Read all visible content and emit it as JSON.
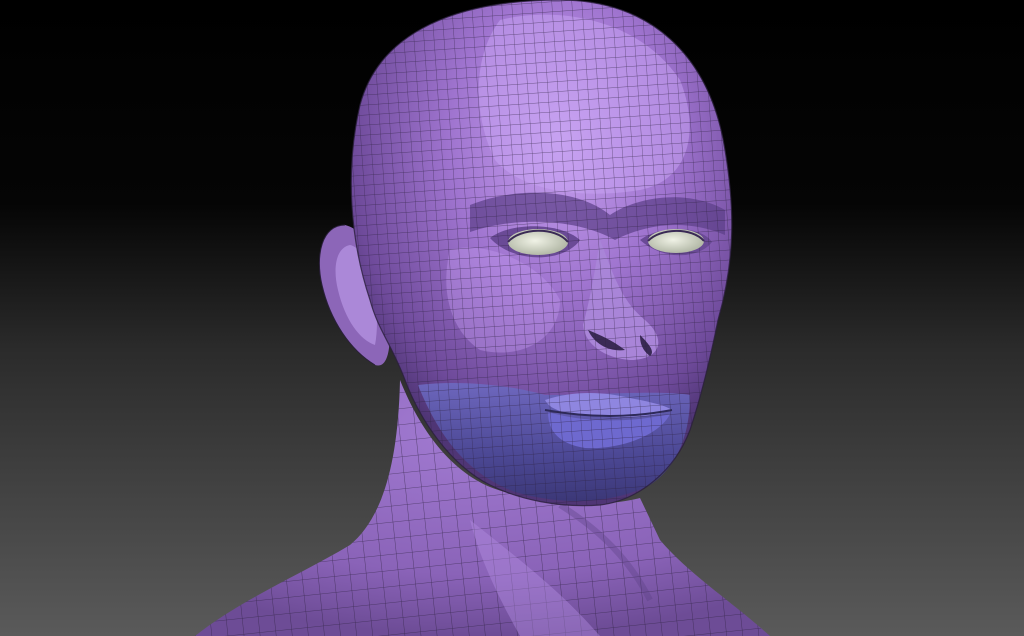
{
  "viewport": {
    "subject": "head-mesh-model",
    "colors": {
      "background_top": "#000000",
      "background_bottom": "#5a5a5a",
      "mesh_light": "#b488e0",
      "mesh_mid": "#8f66bd",
      "mesh_dark": "#5e3f86",
      "lower_face_shade": "#4a4a94",
      "lips": "#6f6fd0",
      "eyes": "#d7dccb",
      "wireframe": "#2a1f3c"
    }
  }
}
